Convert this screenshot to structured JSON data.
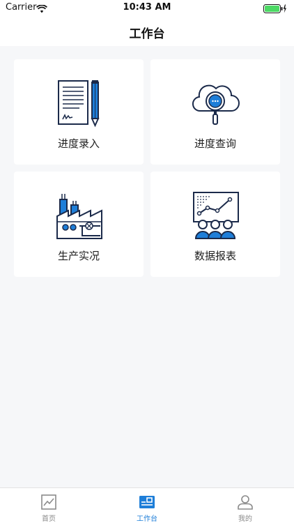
{
  "status_bar": {
    "carrier": "Carrier",
    "time": "10:43 AM"
  },
  "nav": {
    "title": "工作台"
  },
  "cards": [
    {
      "label": "进度录入",
      "icon": "document-pen-icon"
    },
    {
      "label": "进度查询",
      "icon": "cloud-search-icon"
    },
    {
      "label": "生产实况",
      "icon": "factory-icon"
    },
    {
      "label": "数据报表",
      "icon": "data-report-icon"
    }
  ],
  "tabs": [
    {
      "label": "首页",
      "icon": "chart-line-icon",
      "active": false
    },
    {
      "label": "工作台",
      "icon": "workbench-icon",
      "active": true
    },
    {
      "label": "我的",
      "icon": "user-icon",
      "active": false
    }
  ],
  "colors": {
    "accent": "#1e7ed8",
    "icon_dark": "#1b2a4a",
    "battery": "#4cd964",
    "background": "#f6f7f9"
  }
}
